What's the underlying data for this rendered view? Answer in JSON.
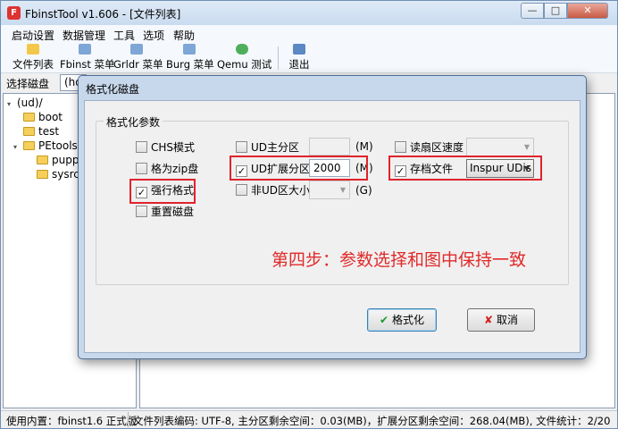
{
  "window": {
    "title": "FbinstTool v1.606 - [文件列表]",
    "buttons": {
      "minimize": "—",
      "maximize": "□",
      "close": "✕"
    }
  },
  "menu": [
    "启动设置",
    "数据管理",
    "工具",
    "选项",
    "帮助"
  ],
  "toolbar": [
    "文件列表",
    "Fbinst 菜单",
    "Grldr 菜单",
    "Burg 菜单",
    "Qemu 测试",
    "退出"
  ],
  "disk": {
    "label": "选择磁盘",
    "value": "(hd"
  },
  "tree": {
    "root": "(ud)/",
    "items": [
      "boot",
      "test",
      "PEtools",
      "puppy",
      "sysrcd"
    ]
  },
  "dialog": {
    "title": "格式化磁盘",
    "group_title": "格式化参数",
    "options": {
      "chs": "CHS模式",
      "zip": "格为zip盘",
      "force": "强行格式",
      "reset": "重置磁盘",
      "ud_primary": "UD主分区",
      "ud_ext": "UD扩展分区",
      "non_ud": "非UD区大小",
      "read_speed": "读扇区速度",
      "archive": "存档文件"
    },
    "checked": {
      "force": true,
      "ud_ext": true,
      "archive": true
    },
    "ud_ext_value": "2000",
    "unit_m": "(M)",
    "unit_g": "(G)",
    "archive_value": "Inspur UDis",
    "ok_button": "格式化",
    "cancel_button": "取消",
    "annotation": "第四步：参数选择和图中保持一致"
  },
  "status": {
    "left": "使用内置：fbinst1.6 正式版",
    "right": "文件列表编码: UTF-8, 主分区剩余空间：0.03(MB)，扩展分区剩余空间：268.04(MB), 文件统计：2/20"
  },
  "colors": {
    "annotation": "#e12a2a",
    "highlight_box": "#e0232b"
  }
}
